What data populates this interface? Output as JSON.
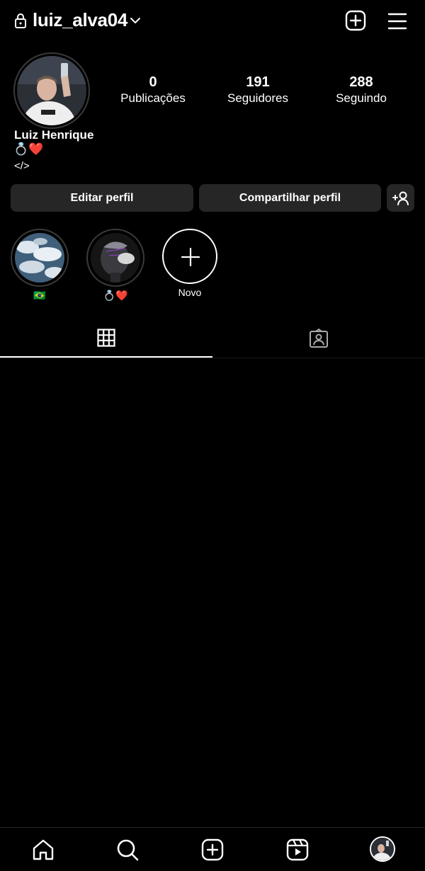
{
  "header": {
    "username": "luiz_alva04"
  },
  "profile": {
    "full_name": "Luiz Henrique",
    "bio_line1": "💍❤️",
    "bio_line2": "</>",
    "stats": {
      "posts_count": "0",
      "posts_label": "Publicações",
      "followers_count": "191",
      "followers_label": "Seguidores",
      "following_count": "288",
      "following_label": "Seguindo"
    }
  },
  "actions": {
    "edit_label": "Editar perfil",
    "share_label": "Compartilhar perfil",
    "discover_icon": "add-person-icon"
  },
  "highlights": [
    {
      "label": "🇧🇷"
    },
    {
      "label": "💍❤️"
    },
    {
      "label": "Novo"
    }
  ],
  "tabs": [
    {
      "icon": "grid-icon",
      "active": true
    },
    {
      "icon": "tagged-icon",
      "active": false
    }
  ],
  "bottom_nav": [
    {
      "icon": "home-icon"
    },
    {
      "icon": "search-icon"
    },
    {
      "icon": "create-icon"
    },
    {
      "icon": "reels-icon"
    },
    {
      "icon": "profile-avatar"
    }
  ],
  "colors": {
    "background": "#000000",
    "button": "#262626",
    "text": "#ffffff"
  }
}
